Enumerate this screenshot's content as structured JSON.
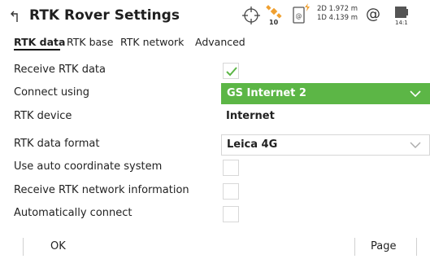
{
  "header": {
    "title": "RTK Rover Settings",
    "satellite_count": "10",
    "precision_2d": "2D 1.972 m",
    "precision_1d": "1D 4.139 m",
    "connection_symbol": "@",
    "battery_label": "14:1",
    "accent_color": "#5cb646",
    "icons": [
      "back-icon",
      "crosshair-icon",
      "satellite-icon",
      "device-icon",
      "at-icon",
      "battery-icon"
    ]
  },
  "tabs": [
    {
      "label": "RTK data",
      "active": true
    },
    {
      "label": "RTK base",
      "active": false
    },
    {
      "label": "RTK network",
      "active": false
    },
    {
      "label": "Advanced",
      "active": false
    }
  ],
  "fields": {
    "receive_rtk_data": {
      "label": "Receive RTK data",
      "checked": true
    },
    "connect_using": {
      "label": "Connect using",
      "value": "GS Internet 2"
    },
    "rtk_device": {
      "label": "RTK device",
      "value": "Internet"
    },
    "rtk_data_format": {
      "label": "RTK data format",
      "value": "Leica 4G"
    },
    "use_auto_coord": {
      "label": "Use auto coordinate system",
      "checked": false
    },
    "receive_network_info": {
      "label": "Receive RTK network information",
      "checked": false
    },
    "auto_connect": {
      "label": "Automatically connect",
      "checked": false
    }
  },
  "footer": {
    "ok_label": "OK",
    "page_label": "Page"
  }
}
